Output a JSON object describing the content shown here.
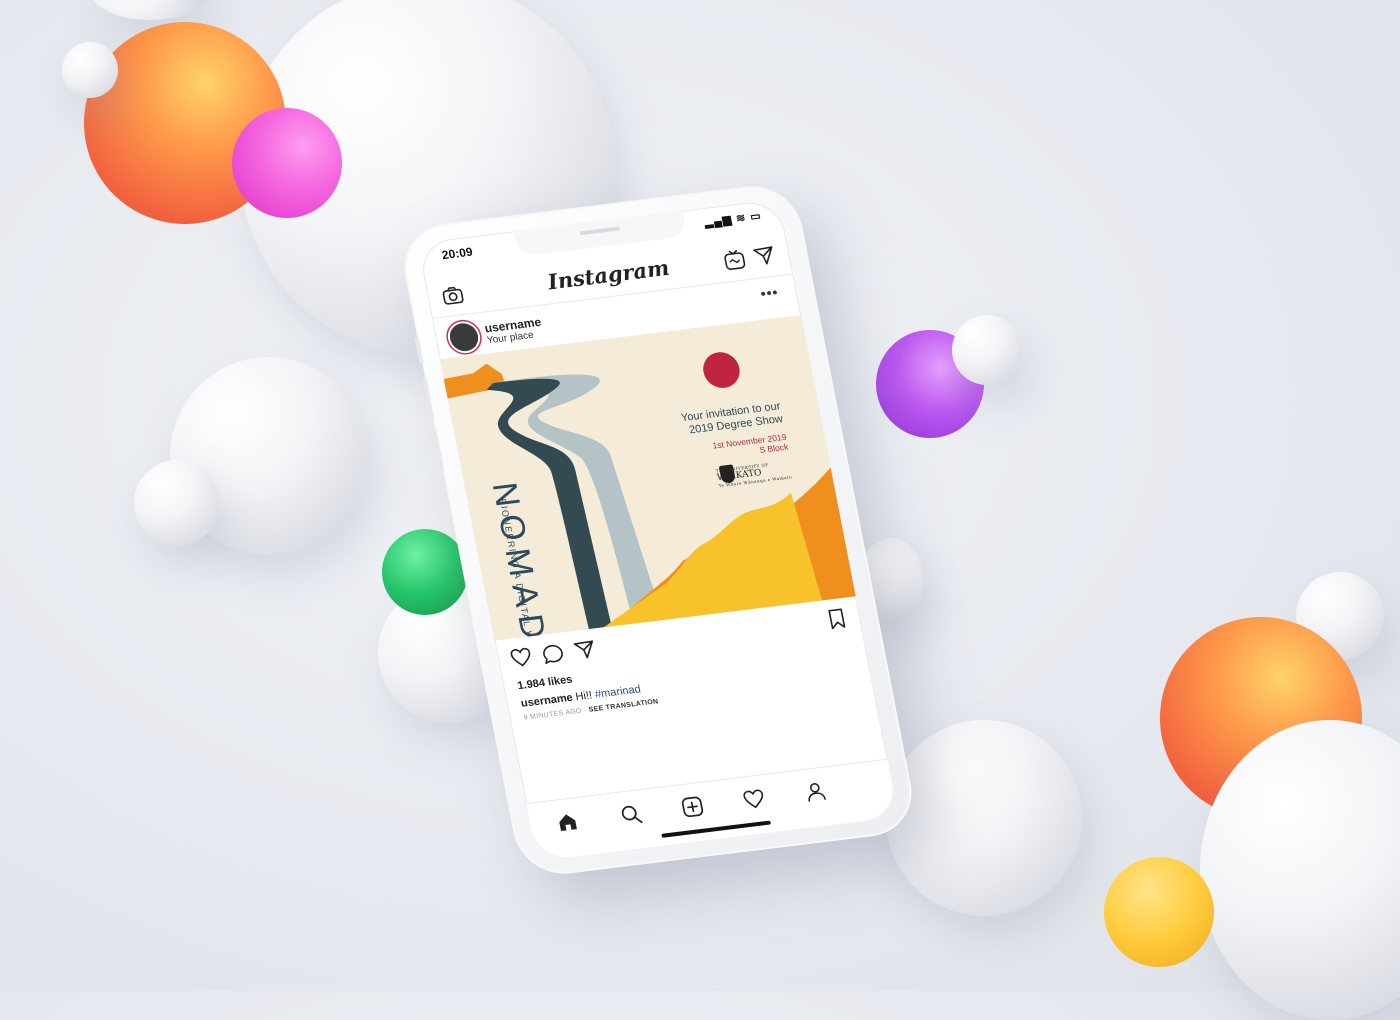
{
  "status": {
    "time": "20:09",
    "icons": "▂▄▆ ≋ ▭"
  },
  "app": {
    "title": "Instagram"
  },
  "post": {
    "username": "username",
    "location": "Your place",
    "more": "•••",
    "image": {
      "title": "NOMAD",
      "subtitle": "PIONEERING A DIGITAL WORLD",
      "invite_line1": "Your invitation to our",
      "invite_line2": "2019 Degree Show",
      "date_line1": "1st November 2019",
      "date_line2": "S Block",
      "uni_small": "THE UNIVERSITY OF",
      "uni_name": "WAIKATO",
      "uni_motto": "Te Whare Wānanga o Waikato"
    },
    "likes": "1.984 likes",
    "caption_user": "username",
    "caption_text": "Hi!!",
    "caption_tag": "#marinad",
    "time_ago": "9 MINUTES AGO",
    "translate": "SEE TRANSLATION"
  },
  "colors": {
    "sun": "#c0243f",
    "road_dark": "#344a52",
    "road_light": "#b4c3c6",
    "hill_orange": "#ee8f1e",
    "hill_yellow": "#f8c22a"
  }
}
